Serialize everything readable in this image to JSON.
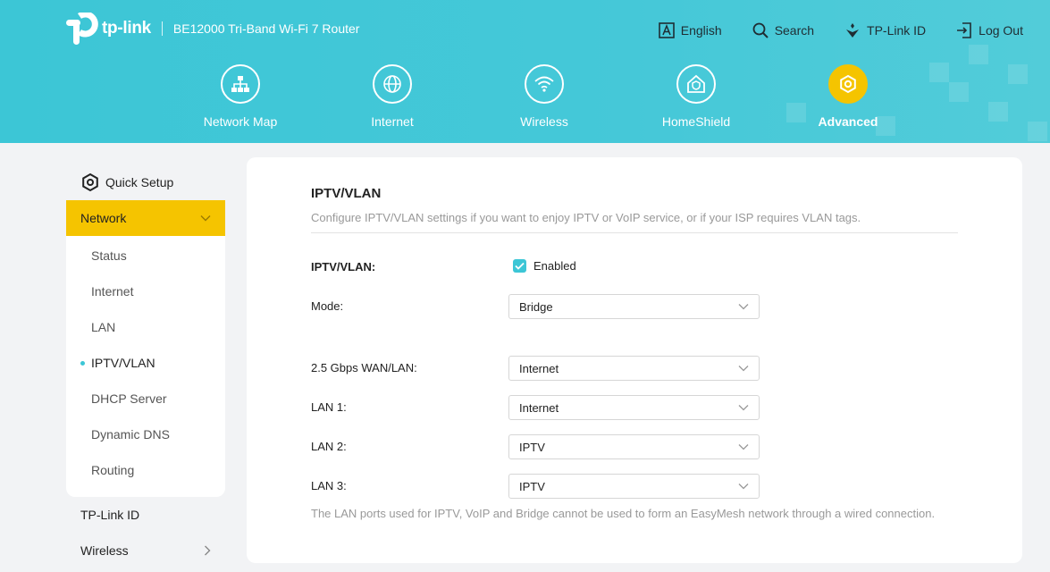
{
  "header": {
    "logo_text": "tp-link",
    "model": "BE12000 Tri-Band Wi-Fi 7 Router",
    "links": [
      {
        "label": "English",
        "icon": "language-icon"
      },
      {
        "label": "Search",
        "icon": "search-icon"
      },
      {
        "label": "TP-Link ID",
        "icon": "tplink-id-icon"
      },
      {
        "label": "Log Out",
        "icon": "logout-icon"
      }
    ],
    "nav": [
      {
        "label": "Network Map",
        "icon": "network-map-icon"
      },
      {
        "label": "Internet",
        "icon": "internet-globe-icon"
      },
      {
        "label": "Wireless",
        "icon": "wifi-icon"
      },
      {
        "label": "HomeShield",
        "icon": "homeshield-icon"
      },
      {
        "label": "Advanced",
        "icon": "gear-icon",
        "active": true
      }
    ]
  },
  "sidebar": {
    "quick_setup": "Quick Setup",
    "network": "Network",
    "sub_items": [
      "Status",
      "Internet",
      "LAN",
      "IPTV/VLAN",
      "DHCP Server",
      "Dynamic DNS",
      "Routing"
    ],
    "active_item": "IPTV/VLAN",
    "tplink_id": "TP-Link ID",
    "wireless": "Wireless"
  },
  "main": {
    "title": "IPTV/VLAN",
    "description": "Configure IPTV/VLAN settings if you want to enjoy IPTV or VoIP service, or if your ISP requires VLAN tags.",
    "iptv_label": "IPTV/VLAN:",
    "enabled_label": "Enabled",
    "enabled": true,
    "mode_label": "Mode:",
    "mode_value": "Bridge",
    "ports": [
      {
        "label": "2.5 Gbps WAN/LAN:",
        "value": "Internet"
      },
      {
        "label": "LAN 1:",
        "value": "Internet"
      },
      {
        "label": "LAN 2:",
        "value": "IPTV"
      },
      {
        "label": "LAN 3:",
        "value": "IPTV"
      }
    ],
    "note": "The LAN ports used for IPTV, VoIP and Bridge cannot be used to form an EasyMesh network through a wired connection."
  },
  "colors": {
    "header_bg": "#3cc6d6",
    "accent_yellow": "#f5c400",
    "checkbox": "#3cc6d6"
  }
}
